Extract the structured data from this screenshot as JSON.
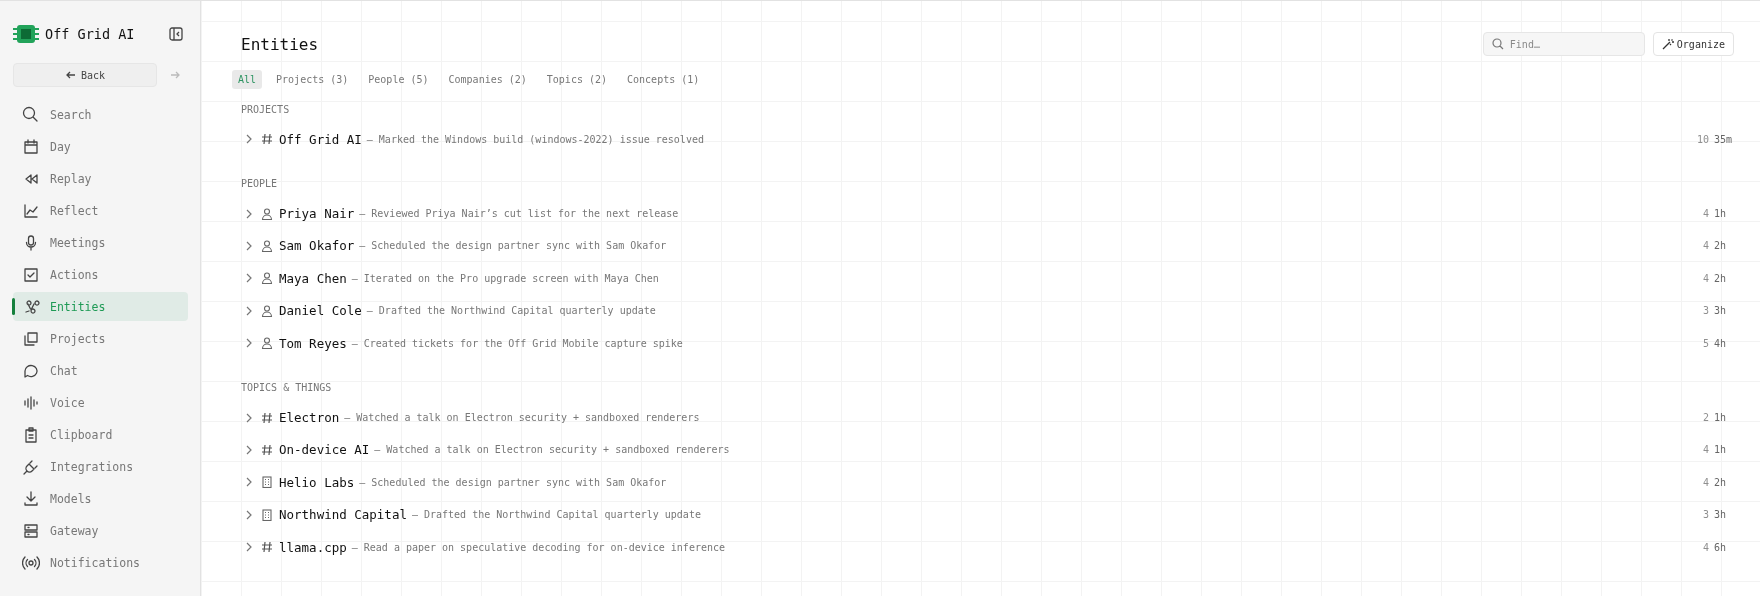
{
  "app": {
    "name": "Off Grid AI"
  },
  "nav": {
    "back": "Back",
    "items": [
      {
        "label": "Search",
        "selected": false
      },
      {
        "label": "Day",
        "selected": false
      },
      {
        "label": "Replay",
        "selected": false
      },
      {
        "label": "Reflect",
        "selected": false
      },
      {
        "label": "Meetings",
        "selected": false
      },
      {
        "label": "Actions",
        "selected": false
      },
      {
        "label": "Entities",
        "selected": true
      },
      {
        "label": "Projects",
        "selected": false
      },
      {
        "label": "Chat",
        "selected": false
      },
      {
        "label": "Voice",
        "selected": false
      },
      {
        "label": "Clipboard",
        "selected": false
      },
      {
        "label": "Integrations",
        "selected": false
      },
      {
        "label": "Models",
        "selected": false
      },
      {
        "label": "Gateway",
        "selected": false
      },
      {
        "label": "Notifications",
        "selected": false
      }
    ]
  },
  "page": {
    "title": "Entities",
    "search": {
      "placeholder": "Find…"
    },
    "organize": "Organize"
  },
  "tabs": [
    {
      "label": "All",
      "selected": true
    },
    {
      "label": "Projects (3)",
      "selected": false
    },
    {
      "label": "People (5)",
      "selected": false
    },
    {
      "label": "Companies (2)",
      "selected": false
    },
    {
      "label": "Topics (2)",
      "selected": false
    },
    {
      "label": "Concepts (1)",
      "selected": false
    }
  ],
  "sections": [
    {
      "title": "PROJECTS",
      "rows": [
        {
          "kind": "topic",
          "name": "Off Grid AI",
          "desc": "— Marked the Windows build (windows-2022) issue resolved",
          "count": "10",
          "age": "35m",
          "expanded": false
        }
      ]
    },
    {
      "title": "PEOPLE",
      "rows": [
        {
          "kind": "person",
          "name": "Priya Nair",
          "desc": "— Reviewed Priya Nair’s cut list for the next release",
          "count": "4",
          "age": "1h",
          "expanded": false
        },
        {
          "kind": "person",
          "name": "Sam Okafor",
          "desc": "— Scheduled the design partner sync with Sam Okafor",
          "count": "4",
          "age": "2h",
          "expanded": false
        },
        {
          "kind": "person",
          "name": "Maya Chen",
          "desc": "— Iterated on the Pro upgrade screen with Maya Chen",
          "count": "4",
          "age": "2h",
          "expanded": false
        },
        {
          "kind": "person",
          "name": "Daniel Cole",
          "desc": "— Drafted the Northwind Capital quarterly update",
          "count": "3",
          "age": "3h",
          "expanded": false
        },
        {
          "kind": "person",
          "name": "Tom Reyes",
          "desc": "— Created tickets for the Off Grid Mobile capture spike",
          "count": "5",
          "age": "4h",
          "expanded": false
        }
      ]
    },
    {
      "title": "TOPICS & THINGS",
      "rows": [
        {
          "kind": "topic",
          "name": "Electron",
          "desc": "— Watched a talk on Electron security + sandboxed renderers",
          "count": "2",
          "age": "1h",
          "expanded": false
        },
        {
          "kind": "topic",
          "name": "On-device AI",
          "desc": "— Watched a talk on Electron security + sandboxed renderers",
          "count": "4",
          "age": "1h",
          "expanded": false
        },
        {
          "kind": "company",
          "name": "Helio Labs",
          "desc": "— Scheduled the design partner sync with Sam Okafor",
          "count": "4",
          "age": "2h",
          "expanded": false
        },
        {
          "kind": "company",
          "name": "Northwind Capital",
          "desc": "— Drafted the Northwind Capital quarterly update",
          "count": "3",
          "age": "3h",
          "expanded": false
        },
        {
          "kind": "topic",
          "name": "llama.cpp",
          "desc": "— Read a paper on speculative decoding for on-device inference",
          "count": "4",
          "age": "6h",
          "expanded": false
        }
      ]
    }
  ]
}
